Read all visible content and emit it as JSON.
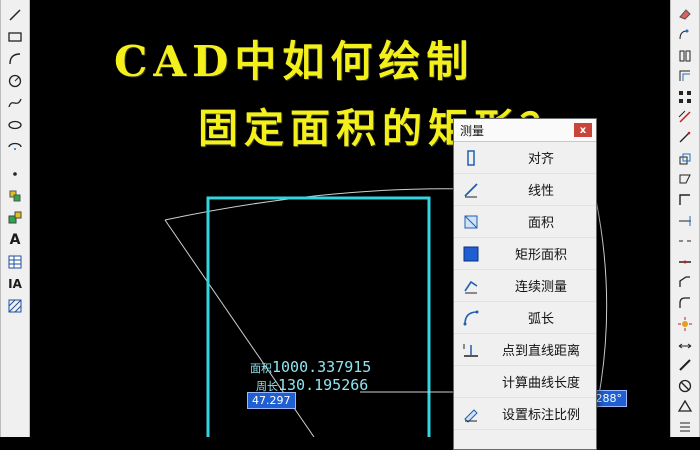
{
  "title": {
    "line1": "CAD中如何绘制",
    "line2": "固定面积的矩形？"
  },
  "measurement": {
    "area_label": "面积",
    "area_value": "1000.337915",
    "perimeter_label": "周长",
    "perimeter_value": "130.195266"
  },
  "dim_inputs": {
    "length": "47.297",
    "angle": "58.288°"
  },
  "dialog": {
    "title": "测量",
    "close": "x",
    "items": [
      {
        "label": "对齐",
        "icon": "align-icon"
      },
      {
        "label": "线性",
        "icon": "linear-icon"
      },
      {
        "label": "面积",
        "icon": "area-icon"
      },
      {
        "label": "矩形面积",
        "icon": "rect-area-icon"
      },
      {
        "label": "连续测量",
        "icon": "continuous-measure-icon"
      },
      {
        "label": "弧长",
        "icon": "arc-length-icon"
      },
      {
        "label": "点到直线距离",
        "icon": "point-line-distance-icon"
      },
      {
        "label": "计算曲线长度",
        "icon": "curve-length-icon"
      },
      {
        "label": "设置标注比例",
        "icon": "annotation-scale-icon"
      }
    ]
  },
  "left_toolbar": [
    "line-icon",
    "rectangle-icon",
    "arc-icon",
    "circle-icon",
    "spline-icon",
    "ellipse-icon",
    "ellipse-arc-icon",
    "point-icon",
    "block-icon",
    "insert-icon",
    "text-icon",
    "table-icon",
    "mtext-icon",
    "hatch-icon"
  ],
  "right_toolbar": [
    "erase-icon",
    "copy-icon",
    "mirror-icon",
    "offset-icon",
    "array-icon",
    "move-icon",
    "rotate-icon",
    "scale-icon",
    "stretch-icon",
    "trim-icon",
    "extend-icon",
    "break-icon",
    "join-icon",
    "chamfer-icon",
    "fillet-icon",
    "explode-icon",
    "dimension-icon",
    "measure-icon",
    "circle-slash-icon",
    "triangle-icon",
    "list-icon"
  ],
  "colors": {
    "canvas": "#000000",
    "title": "#f4f01a",
    "rect_outline": "#33d6e0",
    "measure_text": "#8fe6f0",
    "dim_input_bg": "#1f5fd1"
  }
}
